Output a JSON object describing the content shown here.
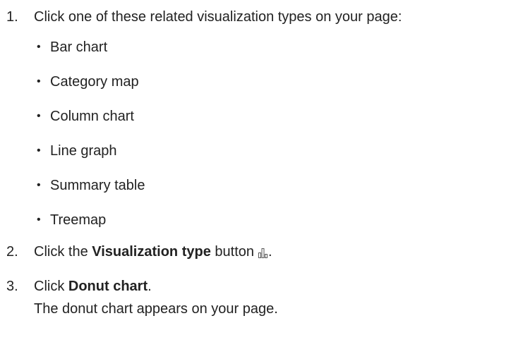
{
  "steps": [
    {
      "number": "1.",
      "text": "Click one of these related visualization types on your page:",
      "items": [
        "Bar chart",
        "Category map",
        "Column chart",
        "Line graph",
        "Summary table",
        "Treemap"
      ]
    },
    {
      "number": "2.",
      "prefix": "Click the ",
      "bold": "Visualization type",
      "suffix": " button",
      "icon": "visualization-type-icon",
      "end": "."
    },
    {
      "number": "3.",
      "prefix": "Click ",
      "bold": "Donut chart",
      "end": ".",
      "result": "The donut chart appears on your page."
    }
  ],
  "bullet_glyph": "•"
}
